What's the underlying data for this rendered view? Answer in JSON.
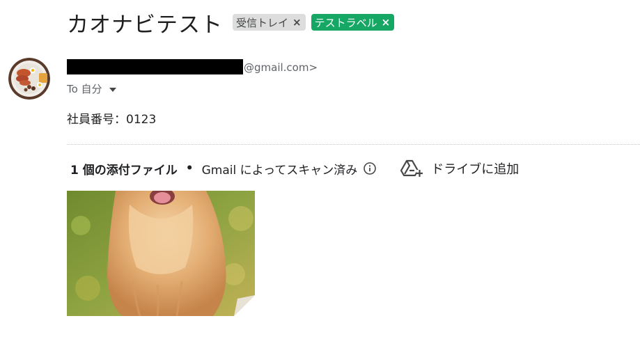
{
  "email": {
    "subject": "カオナビテスト",
    "labels": [
      {
        "name": "受信トレイ",
        "remove": "×"
      },
      {
        "name": "テストラベル",
        "remove": "×"
      }
    ],
    "sender": {
      "email_suffix": "@gmail.com>"
    },
    "recipient": {
      "to_label": "To 自分"
    },
    "body": "社員番号：0123",
    "attachments": {
      "count_text": "1 個の添付ファイル",
      "bullet": "•",
      "scan_text": "Gmail によってスキャン済み",
      "drive_button": "ドライブに追加"
    }
  },
  "colors": {
    "custom_label": "#16a765",
    "inbox_label": "#dddddd",
    "secondary_text": "#5f6368"
  },
  "icons": [
    "info-icon",
    "add-to-drive-icon",
    "chevron-down-icon"
  ]
}
